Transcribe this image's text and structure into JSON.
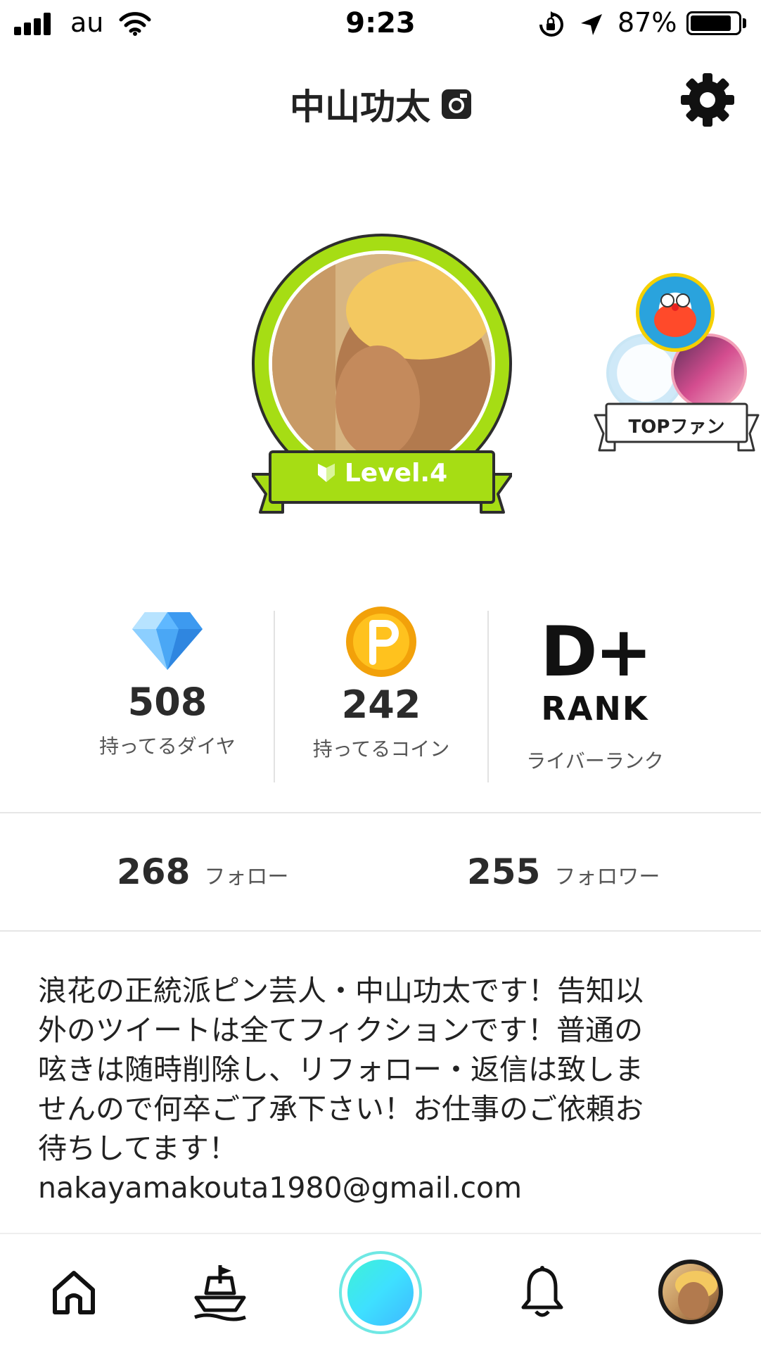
{
  "status_bar": {
    "carrier": "au",
    "time": "9:23",
    "battery_percent": "87%",
    "battery_level": 0.87,
    "icons": [
      "signal-icon",
      "wifi-icon",
      "orientation-lock-icon",
      "location-icon",
      "battery-icon"
    ]
  },
  "header": {
    "title": "中山功太",
    "title_icon": "instagram-icon",
    "settings_icon": "gear-icon"
  },
  "profile": {
    "level_label": "Level.4",
    "level_icon": "beginner-shield-icon",
    "top_fan_label": "TOPファン"
  },
  "stats": [
    {
      "icon": "diamond-icon",
      "value": "508",
      "label": "持ってるダイヤ"
    },
    {
      "icon": "coin-icon",
      "value": "242",
      "label": "持ってるコイン"
    },
    {
      "icon": "rank-badge-icon",
      "rank": "D+",
      "rank_word": "RANK",
      "label": "ライバーランク"
    }
  ],
  "follow": {
    "following_count": "268",
    "following_label": "フォロー",
    "followers_count": "255",
    "followers_label": "フォロワー"
  },
  "bio": "浪花の正統派ピン芸人・中山功太です！告知以\n外のツイートは全てフィクションです！普通の\n呟きは随時削除し、リフォロー・返信は致しま\nせんので何卒ご了承下さい！お仕事のご依頼お\n待ちしてます！\nnakayamakouta1980@gmail.com",
  "bottom_nav": {
    "items": [
      "home-icon",
      "ship-icon",
      "live-button",
      "bell-icon",
      "profile-avatar"
    ],
    "accent": "#3ee0ff",
    "level_green": "#a6dd14"
  }
}
